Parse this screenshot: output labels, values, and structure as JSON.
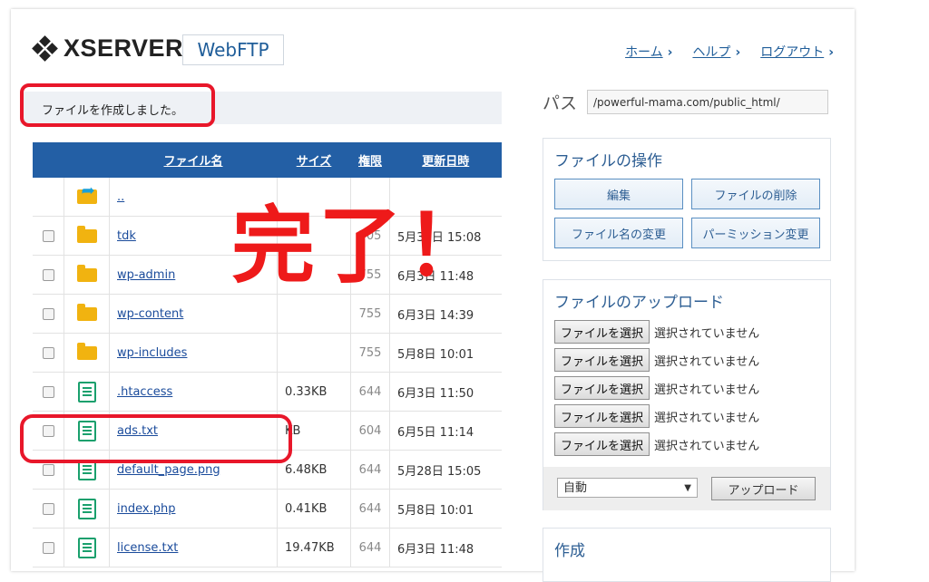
{
  "header": {
    "logo_text": "XSERVER",
    "product": "WebFTP",
    "nav": [
      {
        "label": "ホーム"
      },
      {
        "label": "ヘルプ"
      },
      {
        "label": "ログアウト"
      }
    ]
  },
  "message": "ファイルを作成しました。",
  "annotation": "完了！",
  "table": {
    "headers": {
      "name": "ファイル名",
      "size": "サイズ",
      "perm": "権限",
      "date": "更新日時"
    },
    "parent": "..",
    "rows": [
      {
        "type": "folder",
        "name": "tdk",
        "size": "",
        "perm": "705",
        "date": "5月30日 15:08"
      },
      {
        "type": "folder",
        "name": "wp-admin",
        "size": "",
        "perm": "755",
        "date": "6月3日 11:48"
      },
      {
        "type": "folder",
        "name": "wp-content",
        "size": "",
        "perm": "755",
        "date": "6月3日 14:39"
      },
      {
        "type": "folder",
        "name": "wp-includes",
        "size": "",
        "perm": "755",
        "date": "5月8日 10:01"
      },
      {
        "type": "file",
        "name": ".htaccess",
        "size": "0.33KB",
        "perm": "644",
        "date": "6月3日 11:50"
      },
      {
        "type": "file",
        "name": "ads.txt",
        "size": "KB",
        "perm": "604",
        "date": "6月5日 11:14"
      },
      {
        "type": "file",
        "name": "default_page.png",
        "size": "6.48KB",
        "perm": "644",
        "date": "5月28日 15:05"
      },
      {
        "type": "file",
        "name": "index.php",
        "size": "0.41KB",
        "perm": "644",
        "date": "5月8日 10:01"
      },
      {
        "type": "file",
        "name": "license.txt",
        "size": "19.47KB",
        "perm": "644",
        "date": "6月3日 11:48"
      }
    ]
  },
  "path": {
    "label": "パス",
    "value": "/powerful-mama.com/public_html/"
  },
  "file_ops": {
    "title": "ファイルの操作",
    "buttons": [
      "編集",
      "ファイルの削除",
      "ファイル名の変更",
      "パーミッション変更"
    ]
  },
  "upload": {
    "title": "ファイルのアップロード",
    "choose_label": "ファイルを選択",
    "none_label": "選択されていません",
    "rows": 5,
    "mode": "自動",
    "button": "アップロード"
  },
  "create": {
    "title": "作成"
  },
  "colors": {
    "accent": "#235fa5",
    "highlight": "#e8172a",
    "folder": "#f1b310",
    "file": "#1aa06d"
  }
}
